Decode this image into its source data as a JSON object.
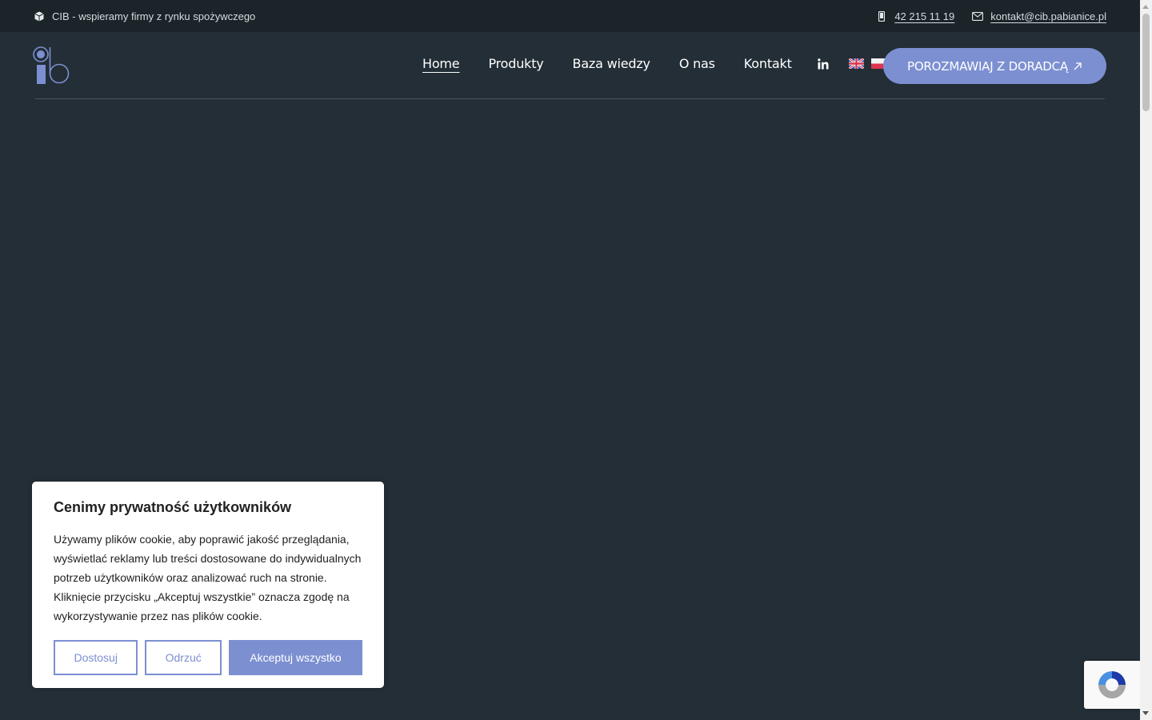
{
  "topbar": {
    "tagline": "CIB - wspieramy firmy z rynku spożywczego",
    "phone": "42 215 11 19",
    "email": "kontakt@cib.pabianice.pl"
  },
  "nav": {
    "items": [
      {
        "label": "Home",
        "active": true
      },
      {
        "label": "Produkty"
      },
      {
        "label": "Baza wiedzy"
      },
      {
        "label": "O nas"
      },
      {
        "label": "Kontakt"
      }
    ],
    "cta_label": "POROZMAWIAJ Z DORADCĄ"
  },
  "cookie": {
    "title": "Cenimy prywatność użytkowników",
    "text": "Używamy plików cookie, aby poprawić jakość przeglądania, wyświetlać reklamy lub treści dostosowane do indywidualnych potrzeb użytkowników oraz analizować ruch na stronie. Kliknięcie przycisku „Akceptuj wszystkie” oznacza zgodę na wykorzystywanie przez nas plików cookie.",
    "customize_label": "Dostosuj",
    "reject_label": "Odrzuć",
    "accept_label": "Akceptuj wszystko"
  },
  "colors": {
    "background": "#232e36",
    "topbar": "#1b2429",
    "accent": "#7c8fd1"
  },
  "icons": [
    "cube-icon",
    "mobile-phone-icon",
    "envelope-icon",
    "linkedin-icon",
    "flag-uk-icon",
    "flag-pl-icon",
    "arrow-up-right-icon",
    "recaptcha-icon"
  ]
}
